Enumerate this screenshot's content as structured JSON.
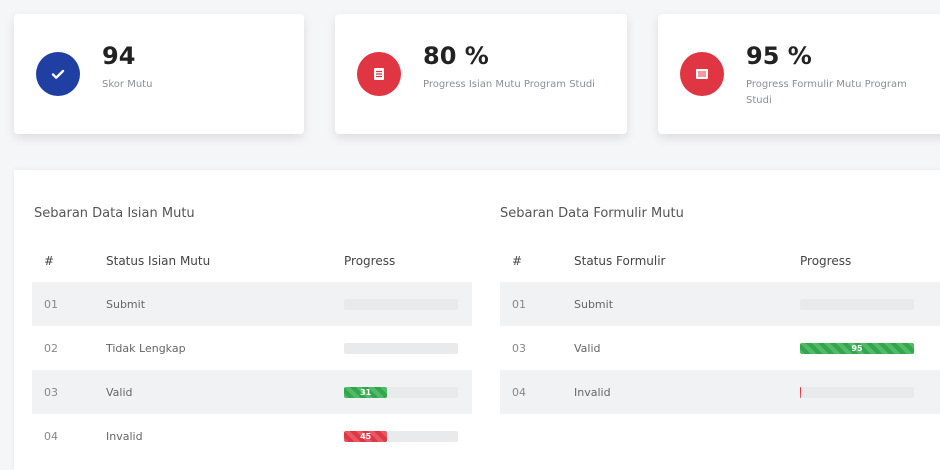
{
  "colors": {
    "blue": "#1f3fa3",
    "red": "#e03542",
    "green": "#2ea84a"
  },
  "stats": [
    {
      "value": "94",
      "label": "Skor Mutu",
      "icon": "check-icon",
      "color": "#1f3fa3"
    },
    {
      "value": "80 %",
      "label": "Progress Isian Mutu Program Studi",
      "icon": "document-list-icon",
      "color": "#e03542"
    },
    {
      "value": "95 %",
      "label": "Progress Formulir Mutu Program Studi",
      "icon": "form-icon",
      "color": "#e03542"
    }
  ],
  "isian": {
    "title": "Sebaran Data Isian Mutu",
    "headers": {
      "num": "#",
      "status": "Status Isian Mutu",
      "progress": "Progress"
    },
    "rows": [
      {
        "num": "01",
        "status": "Submit",
        "progress": 0,
        "label": "",
        "color": "#e9eaec"
      },
      {
        "num": "02",
        "status": "Tidak Lengkap",
        "progress": 0,
        "label": "",
        "color": "#e9eaec"
      },
      {
        "num": "03",
        "status": "Valid",
        "progress": 38,
        "label": "31",
        "color": "#2ea84a"
      },
      {
        "num": "04",
        "status": "Invalid",
        "progress": 38,
        "label": "45",
        "color": "#e03542"
      }
    ]
  },
  "formulir": {
    "title": "Sebaran Data Formulir Mutu",
    "headers": {
      "num": "#",
      "status": "Status Formulir",
      "progress": "Progress"
    },
    "rows": [
      {
        "num": "01",
        "status": "Submit",
        "progress": 0,
        "label": "",
        "color": "#e9eaec"
      },
      {
        "num": "03",
        "status": "Valid",
        "progress": 100,
        "label": "95",
        "color": "#2ea84a"
      },
      {
        "num": "04",
        "status": "Invalid",
        "progress": 1,
        "label": "",
        "color": "#e03542"
      }
    ]
  }
}
